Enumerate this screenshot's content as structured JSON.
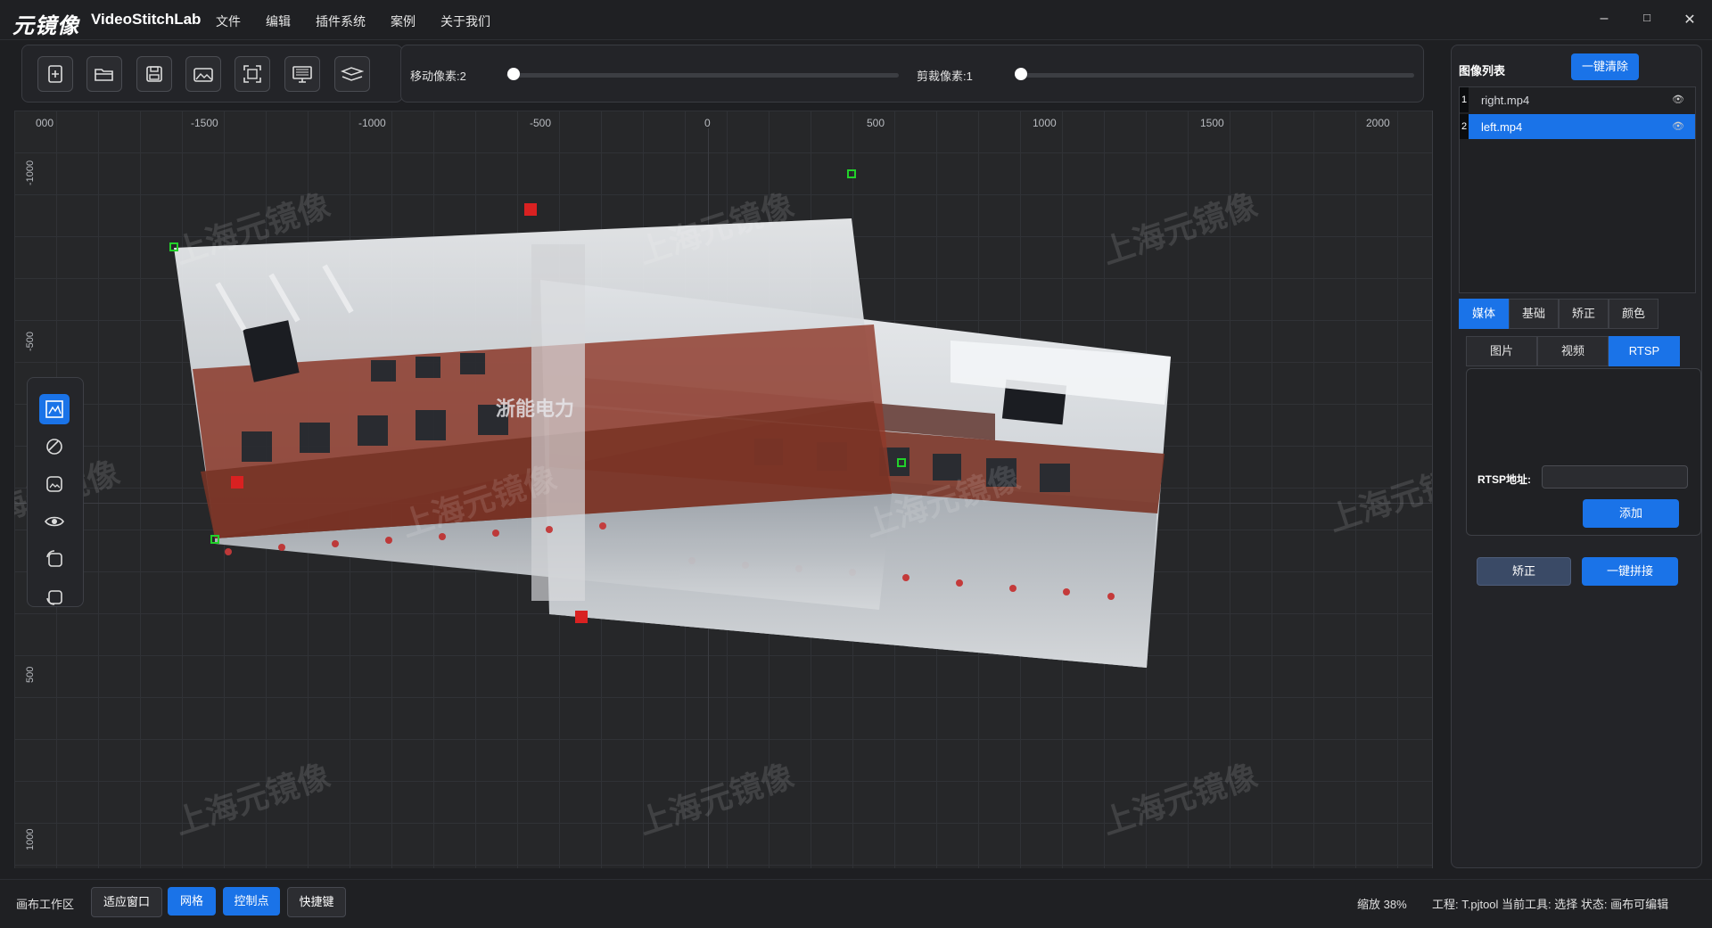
{
  "app": {
    "logo": "元镜像",
    "name": "VideoStitchLab"
  },
  "menu": [
    "文件",
    "编辑",
    "插件系统",
    "案例",
    "关于我们"
  ],
  "window": {
    "minimize": "–",
    "maximize": "□",
    "close": "✕"
  },
  "toolbar": {
    "tools": [
      "new-file-icon",
      "open-folder-icon",
      "save-icon",
      "image-edit-icon",
      "select-frame-icon",
      "monitor-icon",
      "stitch-icon"
    ],
    "move_label": "移动像素:2",
    "move_value": 2,
    "crop_label": "剪裁像素:1",
    "crop_value": 1
  },
  "ruler": {
    "x": [
      "000",
      "-1500",
      "-1000",
      "-500",
      "0",
      "500",
      "1000",
      "1500",
      "2000"
    ],
    "y": [
      "-1000",
      "-500",
      "500",
      "1000"
    ]
  },
  "watermark": "上海元镜像",
  "scene_banner": "浙能电力",
  "palette": [
    "warp-select-icon",
    "blend-icon",
    "image-adjust-icon",
    "visibility-icon",
    "rotate-image-icon",
    "crop-image-icon"
  ],
  "right_panel": {
    "list_title": "图像列表",
    "clear_button": "一键清除",
    "images": [
      {
        "index": "1",
        "name": "right.mp4",
        "selected": false
      },
      {
        "index": "2",
        "name": "left.mp4",
        "selected": true
      }
    ],
    "main_tabs": [
      "媒体",
      "基础",
      "矫正",
      "颜色"
    ],
    "sub_tabs": [
      "图片",
      "视频",
      "RTSP"
    ],
    "rtsp_label": "RTSP地址:",
    "rtsp_value": "",
    "add_button": "添加",
    "correct_button": "矫正",
    "stitch_button": "一键拼接"
  },
  "statusbar": {
    "workspace": "画布工作区",
    "fit_button": "适应窗口",
    "grid_button": "网格",
    "control_button": "控制点",
    "shortcut_button": "快捷键",
    "zoom": "缩放 38%",
    "info": "工程: T.pjtool  当前工具: 选择  状态: 画布可编辑"
  },
  "colors": {
    "accent": "#1a73e8",
    "handle_green": "#22d22a",
    "handle_red": "#d92121"
  }
}
